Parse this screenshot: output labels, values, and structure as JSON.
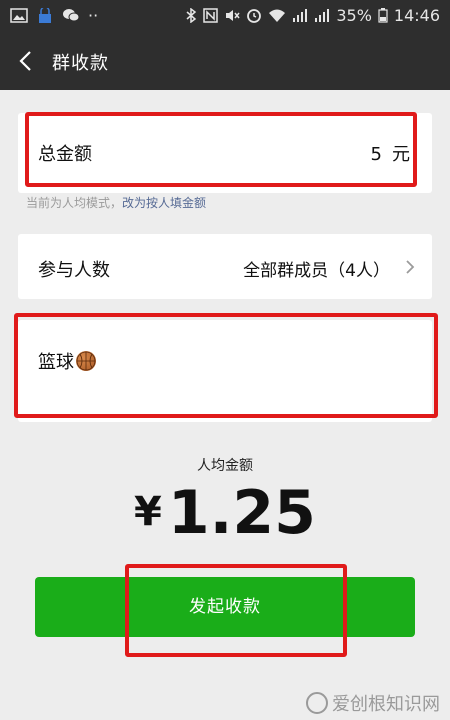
{
  "status_bar": {
    "battery": "35%",
    "time": "14:46",
    "dots": "··"
  },
  "nav": {
    "title": "群收款"
  },
  "total": {
    "label": "总金额",
    "amount": "5",
    "unit": "元"
  },
  "hint": {
    "text": "当前为人均模式，",
    "link": "改为按人填金额"
  },
  "participants": {
    "label": "参与人数",
    "value": "全部群成员（4人）"
  },
  "note": {
    "text": "篮球"
  },
  "average": {
    "label": "人均金额",
    "currency": "¥",
    "amount": "1.25"
  },
  "cta": {
    "label": "发起收款"
  },
  "watermark": {
    "text": "爱创根知识网"
  },
  "colors": {
    "nav_bg": "#2e2e2e",
    "primary_green": "#1aad19",
    "highlight_red": "#e01a1a",
    "link_blue": "#576b95"
  }
}
